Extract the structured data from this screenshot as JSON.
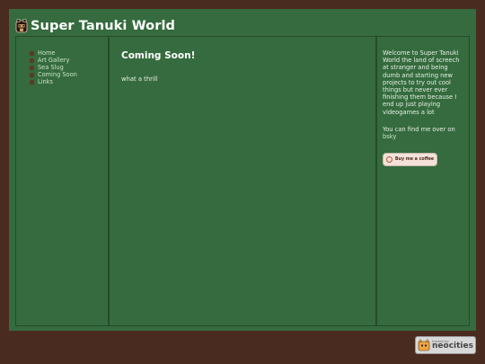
{
  "header": {
    "title": "Super Tanuki World",
    "logo_icon": "tanuki-icon"
  },
  "nav": {
    "items": [
      {
        "label": "Home"
      },
      {
        "label": "Art Gallery"
      },
      {
        "label": "Sea Slug"
      },
      {
        "label": "Coming Soon"
      },
      {
        "label": "Links"
      }
    ]
  },
  "main": {
    "title": "Coming Soon!",
    "text": "what a thrill"
  },
  "sidebar_right": {
    "welcome": "Welcome to Super Tanuki World the land of screech at stranger and being dumb and starting new projects to try out cool things but never ever finishing them because I end up just playing videogames a lot",
    "find_text": "You can find me over on",
    "find_link": "bsky",
    "coffee_button": "Buy me a coffee"
  },
  "footer": {
    "badge_small": "hosted by",
    "badge_big": "neocities"
  },
  "colors": {
    "background": "#4a2b1f",
    "panel": "#356b3e",
    "border": "#264a2c",
    "link": "#c9e6c5",
    "bullet": "#5b3b22"
  }
}
